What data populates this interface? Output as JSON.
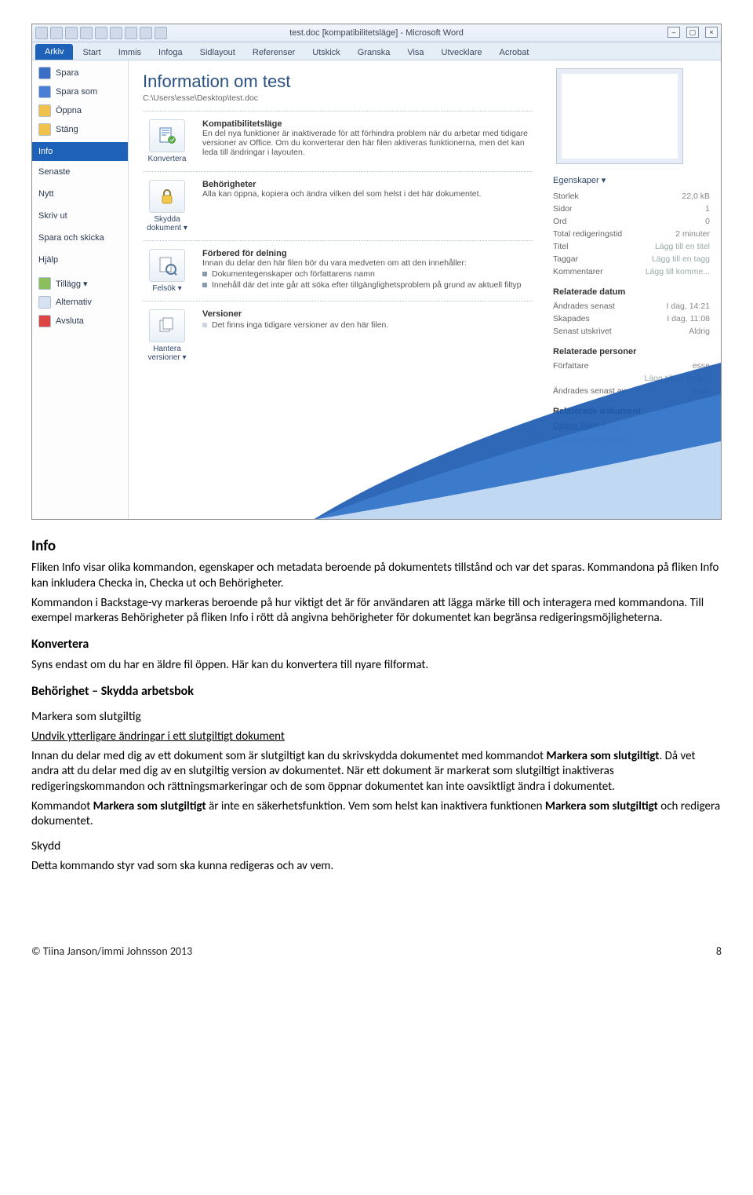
{
  "window": {
    "title": "test.doc [kompatibilitetsläge] - Microsoft Word"
  },
  "ribbon": {
    "arkiv": "Arkiv",
    "tabs": [
      "Start",
      "Immis",
      "Infoga",
      "Sidlayout",
      "Referenser",
      "Utskick",
      "Granska",
      "Visa",
      "Utvecklare",
      "Acrobat"
    ]
  },
  "sidebar": {
    "spara": "Spara",
    "sparasom": "Spara som",
    "oppna": "Öppna",
    "stang": "Stäng",
    "info": "Info",
    "senaste": "Senaste",
    "nytt": "Nytt",
    "skrivut": "Skriv ut",
    "sparaochskicka": "Spara och skicka",
    "hjalp": "Hjälp",
    "tillagg": "Tillägg ▾",
    "alternativ": "Alternativ",
    "avsluta": "Avsluta"
  },
  "info": {
    "heading": "Information om test",
    "path": "C:\\Users\\esse\\Desktop\\test.doc",
    "konvertera": {
      "btn": "Konvertera",
      "title": "Kompatibilitetsläge",
      "body": "En del nya funktioner är inaktiverade för att förhindra problem när du arbetar med tidigare versioner av Office. Om du konverterar den här filen aktiveras funktionerna, men det kan leda till ändringar i layouten."
    },
    "skydda": {
      "btn": "Skydda dokument ▾",
      "title": "Behörigheter",
      "body": "Alla kan öppna, kopiera och ändra vilken del som helst i det här dokumentet."
    },
    "felsok": {
      "btn": "Felsök ▾",
      "title": "Förbered för delning",
      "intro": "Innan du delar den här filen bör du vara medveten om att den innehåller:",
      "b1": "Dokumentegenskaper och författarens namn",
      "b2": "Innehåll där det inte går att söka efter tillgänglighetsproblem på grund av aktuell filtyp"
    },
    "versioner": {
      "btn": "Hantera versioner ▾",
      "title": "Versioner",
      "body": "Det finns inga tidigare versioner av den här filen."
    }
  },
  "props": {
    "label": "Egenskaper ▾",
    "storlek_l": "Storlek",
    "storlek_v": "22,0 kB",
    "sidor_l": "Sidor",
    "sidor_v": "1",
    "ord_l": "Ord",
    "ord_v": "0",
    "redig_l": "Total redigeringstid",
    "redig_v": "2 minuter",
    "titel_l": "Titel",
    "titel_v": "Lägg till en titel",
    "taggar_l": "Taggar",
    "taggar_v": "Lägg till en tagg",
    "komm_l": "Kommentarer",
    "komm_v": "Lägg till komme...",
    "related_dates": "Relaterade datum",
    "andsen_l": "Ändrades senast",
    "andsen_v": "I dag, 14:21",
    "skap_l": "Skapades",
    "skap_v": "I dag, 11:08",
    "utsk_l": "Senast utskrivet",
    "utsk_v": "Aldrig",
    "related_people": "Relaterade personer",
    "forf_l": "Författare",
    "forf_v": "esse",
    "forf_add": "Lägg till en förfa...",
    "andav_l": "Ändrades senast av",
    "andav_v": "esse",
    "related_docs": "Relaterade dokument",
    "openloc": "Öppna filens mapp",
    "showall": "Visa alla egenskaper"
  },
  "doc": {
    "h_info": "Info",
    "p1": "Fliken Info visar olika kommandon, egenskaper och metadata beroende på dokumentets tillstånd och var det sparas. Kommandona på fliken Info kan inkludera Checka in, Checka ut och Behörigheter.",
    "p2a": "Kommandon i Backstage-vy markeras beroende på hur viktigt det är för användaren att lägga märke till och interagera med kommandona. Till exempel markeras Behörigheter på fliken Info ",
    "p2b": "i rött då angivna behörigheter för dokumentet kan begränsa redigeringsmöjligheterna.",
    "h_konv": "Konvertera",
    "p3": "Syns endast om du har en äldre fil öppen. Här kan du konvertera till nyare filformat.",
    "h_beh": "Behörighet – Skydda arbetsbok",
    "h_mark": "Markera som slutgiltig",
    "und": "Undvik ytterligare ändringar i ett slutgiltigt dokument",
    "p4a": "Innan du delar med dig av ett dokument som är slutgiltigt kan du skrivskydda dokumentet med kommandot ",
    "p4b": "Markera som slutgiltigt",
    "p4c": ". Då vet andra att du delar med dig av en slutgiltig version av dokumentet. När ett dokument är markerat som slutgiltigt inaktiveras redigeringskommandon och rättningsmarkeringar och de som öppnar dokumentet kan inte oavsiktligt ändra i dokumentet.",
    "p5a": "Kommandot ",
    "p5b": "Markera som slutgiltigt",
    "p5c": " är inte en säkerhetsfunktion. Vem som helst kan inaktivera funktionen ",
    "p5d": "Markera som slutgiltigt",
    "p5e": " och redigera dokumentet.",
    "h_skydd": "Skydd",
    "p6": "Detta kommando styr vad som ska kunna redigeras och av vem."
  },
  "footer": {
    "left": "© Tiina Janson/immi Johnsson 2013",
    "right": "8"
  }
}
